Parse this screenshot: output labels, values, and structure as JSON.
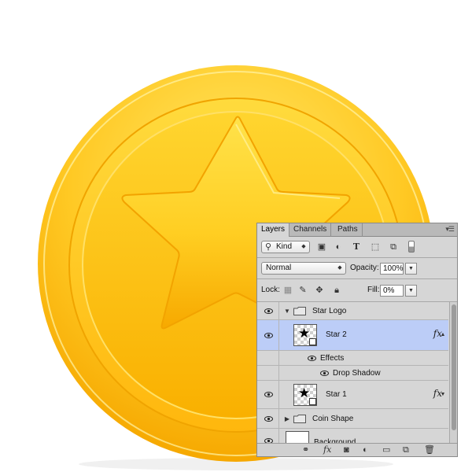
{
  "panel": {
    "tabs": [
      {
        "label": "Layers",
        "active": true
      },
      {
        "label": "Channels",
        "active": false
      },
      {
        "label": "Paths",
        "active": false
      }
    ],
    "filter": {
      "label": "Kind",
      "icons": [
        "image-filter-icon",
        "adjustment-filter-icon",
        "type-filter-icon",
        "shape-filter-icon",
        "smart-object-filter-icon",
        "filter-toggle-icon"
      ]
    },
    "blend_mode": "Normal",
    "opacity": {
      "label": "Opacity:",
      "value": "100%"
    },
    "lock": {
      "label": "Lock:",
      "icons": [
        "lock-transparent-icon",
        "lock-pixels-icon",
        "lock-position-icon",
        "lock-all-icon"
      ]
    },
    "fill": {
      "label": "Fill:",
      "value": "0%"
    },
    "layers": [
      {
        "name": "Star Logo",
        "type": "group",
        "expanded": true
      },
      {
        "name": "Star 2",
        "type": "smart-object",
        "selected": true,
        "fx": "fx"
      },
      {
        "name": "Effects",
        "type": "effects"
      },
      {
        "name": "Drop Shadow",
        "type": "effect"
      },
      {
        "name": "Star 1",
        "type": "smart-object",
        "fx": "fx"
      },
      {
        "name": "Coin Shape",
        "type": "group",
        "expanded": false
      },
      {
        "name": "Background",
        "type": "layer"
      }
    ],
    "footer_icons": [
      "link-layers-icon",
      "fx-icon",
      "add-mask-icon",
      "adjustment-layer-icon",
      "new-group-icon",
      "new-layer-icon",
      "delete-icon"
    ],
    "colors": {
      "selected": "#bccdf7",
      "panel": "#d6d6d6"
    }
  },
  "artwork": {
    "subject": "gold coin with star",
    "colors": {
      "gold_light": "#ffe15a",
      "gold_mid": "#ffc81e",
      "gold_dark": "#f2a000"
    }
  }
}
